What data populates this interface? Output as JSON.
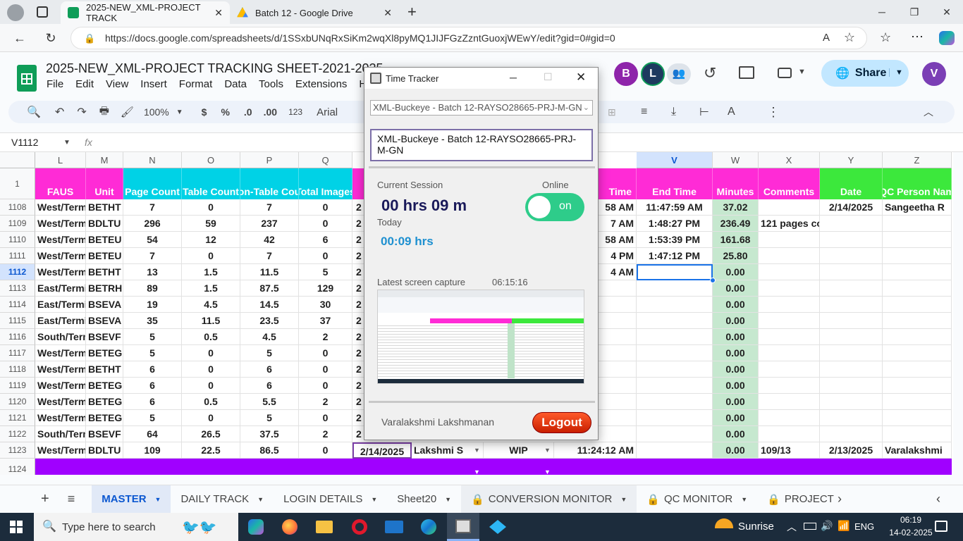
{
  "browser": {
    "tabs": [
      {
        "title": "2025-NEW_XML-PROJECT TRACK"
      },
      {
        "title": "Batch 12 - Google Drive"
      }
    ],
    "url": "https://docs.google.com/spreadsheets/d/1SSxbUNqRxSiKm2wqXl8pyMQ1JIJFGzZzntGuoxjWEwY/edit?gid=0#gid=0"
  },
  "sheets": {
    "title": "2025-NEW_XML-PROJECT TRACKING SHEET-2021-2025",
    "menus": [
      "File",
      "Edit",
      "View",
      "Insert",
      "Format",
      "Data",
      "Tools",
      "Extensions",
      "Help"
    ],
    "zoom": "100%",
    "currency": "$",
    "percent": "%",
    "dec_less": ".0",
    "dec_more": ".00",
    "number_fmt": "123",
    "font": "Arial",
    "name_box": "V1112",
    "fx": "fx",
    "share_label": "Share",
    "avatars": [
      {
        "letter": "B",
        "color": "#8e24aa"
      },
      {
        "letter": "L",
        "color": "#1e3a5f"
      },
      {
        "letter": "V",
        "color": "#7b3fb5"
      }
    ]
  },
  "grid": {
    "columns": [
      "L",
      "M",
      "N",
      "O",
      "P",
      "Q",
      "V",
      "W",
      "X",
      "Y",
      "Z"
    ],
    "header_row_num": "1",
    "headers": {
      "L": "FAUS",
      "M": "Unit",
      "N": "Page Count",
      "O": "Table Count",
      "P": "on-Table Cou",
      "Q": "Total Images",
      "T": "Time",
      "V": "End Time",
      "W": "Minutes",
      "X": "Comments",
      "Y": "Date",
      "Z": "QC Person Nam"
    },
    "rows": [
      {
        "num": "1108",
        "L": "West/Termi",
        "M": "BETHT",
        "N": "7",
        "O": "0",
        "P": "7",
        "Q": "0",
        "T": "58 AM",
        "V": "11:47:59 AM",
        "W": "37.02",
        "X": "",
        "Y": "2/14/2025",
        "Z": "Sangeetha R"
      },
      {
        "num": "1109",
        "L": "West/Termi",
        "M": "BDLTU",
        "N": "296",
        "O": "59",
        "P": "237",
        "Q": "0",
        "T": "7 AM",
        "V": "1:48:27 PM",
        "W": "236.49",
        "X": "121 pages co",
        "Y": "",
        "Z": ""
      },
      {
        "num": "1110",
        "L": "West/Termi",
        "M": "BETEU",
        "N": "54",
        "O": "12",
        "P": "42",
        "Q": "6",
        "T": "58 AM",
        "V": "1:53:39 PM",
        "W": "161.68",
        "X": "",
        "Y": "",
        "Z": ""
      },
      {
        "num": "1111",
        "L": "West/Termi",
        "M": "BETEU",
        "N": "7",
        "O": "0",
        "P": "7",
        "Q": "0",
        "T": "4 PM",
        "V": "1:47:12 PM",
        "W": "25.80",
        "X": "",
        "Y": "",
        "Z": ""
      },
      {
        "num": "1112",
        "L": "West/Termi",
        "M": "BETHT",
        "N": "13",
        "O": "1.5",
        "P": "11.5",
        "Q": "5",
        "T": "4 AM",
        "V": "",
        "W": "0.00",
        "X": "",
        "Y": "",
        "Z": ""
      },
      {
        "num": "1113",
        "L": "East/Termir",
        "M": "BETRH",
        "N": "89",
        "O": "1.5",
        "P": "87.5",
        "Q": "129",
        "T": "",
        "V": "",
        "W": "0.00",
        "X": "",
        "Y": "",
        "Z": ""
      },
      {
        "num": "1114",
        "L": "East/Termir",
        "M": "BSEVA",
        "N": "19",
        "O": "4.5",
        "P": "14.5",
        "Q": "30",
        "T": "",
        "V": "",
        "W": "0.00",
        "X": "",
        "Y": "",
        "Z": ""
      },
      {
        "num": "1115",
        "L": "East/Termir",
        "M": "BSEVA",
        "N": "35",
        "O": "11.5",
        "P": "23.5",
        "Q": "37",
        "T": "",
        "V": "",
        "W": "0.00",
        "X": "",
        "Y": "",
        "Z": ""
      },
      {
        "num": "1116",
        "L": "South/Term",
        "M": "BSEVF",
        "N": "5",
        "O": "0.5",
        "P": "4.5",
        "Q": "2",
        "T": "",
        "V": "",
        "W": "0.00",
        "X": "",
        "Y": "",
        "Z": ""
      },
      {
        "num": "1117",
        "L": "West/Termi",
        "M": "BETEG",
        "N": "5",
        "O": "0",
        "P": "5",
        "Q": "0",
        "T": "",
        "V": "",
        "W": "0.00",
        "X": "",
        "Y": "",
        "Z": ""
      },
      {
        "num": "1118",
        "L": "West/Termi",
        "M": "BETHT",
        "N": "6",
        "O": "0",
        "P": "6",
        "Q": "0",
        "T": "",
        "V": "",
        "W": "0.00",
        "X": "",
        "Y": "",
        "Z": ""
      },
      {
        "num": "1119",
        "L": "West/Termi",
        "M": "BETEG",
        "N": "6",
        "O": "0",
        "P": "6",
        "Q": "0",
        "T": "",
        "V": "",
        "W": "0.00",
        "X": "",
        "Y": "",
        "Z": ""
      },
      {
        "num": "1120",
        "L": "West/Termi",
        "M": "BETEG",
        "N": "6",
        "O": "0.5",
        "P": "5.5",
        "Q": "2",
        "T": "",
        "V": "",
        "W": "0.00",
        "X": "",
        "Y": "",
        "Z": ""
      },
      {
        "num": "1121",
        "L": "West/Termi",
        "M": "BETEG",
        "N": "5",
        "O": "0",
        "P": "5",
        "Q": "0",
        "T": "",
        "V": "",
        "W": "0.00",
        "X": "",
        "Y": "",
        "Z": ""
      },
      {
        "num": "1122",
        "L": "South/Term",
        "M": "BSEVF",
        "N": "64",
        "O": "26.5",
        "P": "37.5",
        "Q": "2",
        "T": "",
        "V": "",
        "W": "0.00",
        "X": "",
        "Y": "",
        "Z": ""
      },
      {
        "num": "1123",
        "L": "West/Termi",
        "M": "BDLTU",
        "N": "109",
        "O": "22.5",
        "P": "86.5",
        "Q": "0",
        "T": "11:24:12 AM",
        "V": "",
        "W": "0.00",
        "X": "109/13",
        "Y": "2/13/2025",
        "Z": "Varalakshmi"
      }
    ],
    "row1123_extra": {
      "date": "2/14/2025",
      "person": "Lakshmi S",
      "status": "WIP"
    },
    "last_row_num": "1124",
    "partial_col_digit": "2"
  },
  "sheet_tabs": [
    "MASTER",
    "DAILY TRACK",
    "LOGIN DETAILS",
    "Sheet20",
    "CONVERSION MONITOR",
    "QC MONITOR",
    "PROJECT S"
  ],
  "time_tracker": {
    "title": "Time Tracker",
    "select_value": "XML-Buckeye - Batch 12-RAYSO28665-PRJ-M-GN",
    "text_value": "XML-Buckeye - Batch 12-RAYSO28665-PRJ-M-GN",
    "current_session_label": "Current Session",
    "online_label": "Online",
    "session_time": "00 hrs 09 m",
    "toggle_text": "on",
    "today_label": "Today",
    "today_time": "00:09 hrs",
    "capture_label": "Latest screen capture",
    "capture_time": "06:15:16",
    "user_name": "Varalakshmi Lakshmanan",
    "logout_label": "Logout"
  },
  "taskbar": {
    "search_placeholder": "Type here to search",
    "weather": "Sunrise",
    "lang": "ENG",
    "time": "06:19",
    "date": "14-02-2025"
  }
}
